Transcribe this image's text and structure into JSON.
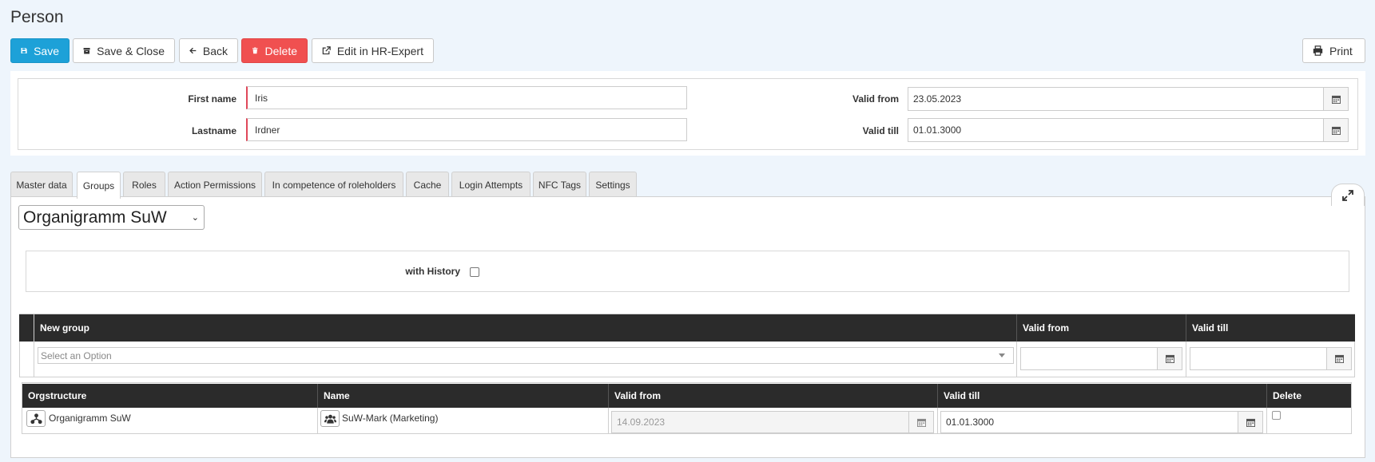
{
  "page": {
    "title": "Person"
  },
  "toolbar": {
    "save": "Save",
    "save_close": "Save & Close",
    "back": "Back",
    "delete": "Delete",
    "edit_hr": "Edit in HR-Expert",
    "print": "Print"
  },
  "header_form": {
    "first_name_label": "First name",
    "first_name_value": "Iris",
    "lastname_label": "Lastname",
    "lastname_value": "Irdner",
    "valid_from_label": "Valid from",
    "valid_from_value": "23.05.2023",
    "valid_till_label": "Valid till",
    "valid_till_value": "01.01.3000"
  },
  "tabs": [
    {
      "label": "Master data",
      "active": false
    },
    {
      "label": "Groups",
      "active": true
    },
    {
      "label": "Roles",
      "active": false
    },
    {
      "label": "Action Permissions",
      "active": false
    },
    {
      "label": "In competence of roleholders",
      "active": false
    },
    {
      "label": "Cache",
      "active": false
    },
    {
      "label": "Login Attempts",
      "active": false
    },
    {
      "label": "NFC Tags",
      "active": false
    },
    {
      "label": "Settings",
      "active": false
    }
  ],
  "groups": {
    "org_select_value": "Organigramm SuW",
    "with_history_label": "with History",
    "with_history_checked": false,
    "new_group_table": {
      "headers": [
        "New group",
        "Valid from",
        "Valid till"
      ],
      "select_placeholder": "Select an Option",
      "valid_from": "",
      "valid_till": ""
    },
    "assigned_table": {
      "headers": [
        "Orgstructure",
        "Name",
        "Valid from",
        "Valid till",
        "Delete"
      ],
      "rows": [
        {
          "orgstructure": "Organigramm SuW",
          "name": "SuW-Mark (Marketing)",
          "valid_from": "14.09.2023",
          "valid_till": "01.01.3000",
          "delete": false
        }
      ]
    }
  },
  "colors": {
    "primary": "#1da1d8",
    "danger": "#f05050",
    "grid_header": "#2b2b2b",
    "page_bg": "#eef5fc",
    "required_marker": "#e0485a"
  }
}
